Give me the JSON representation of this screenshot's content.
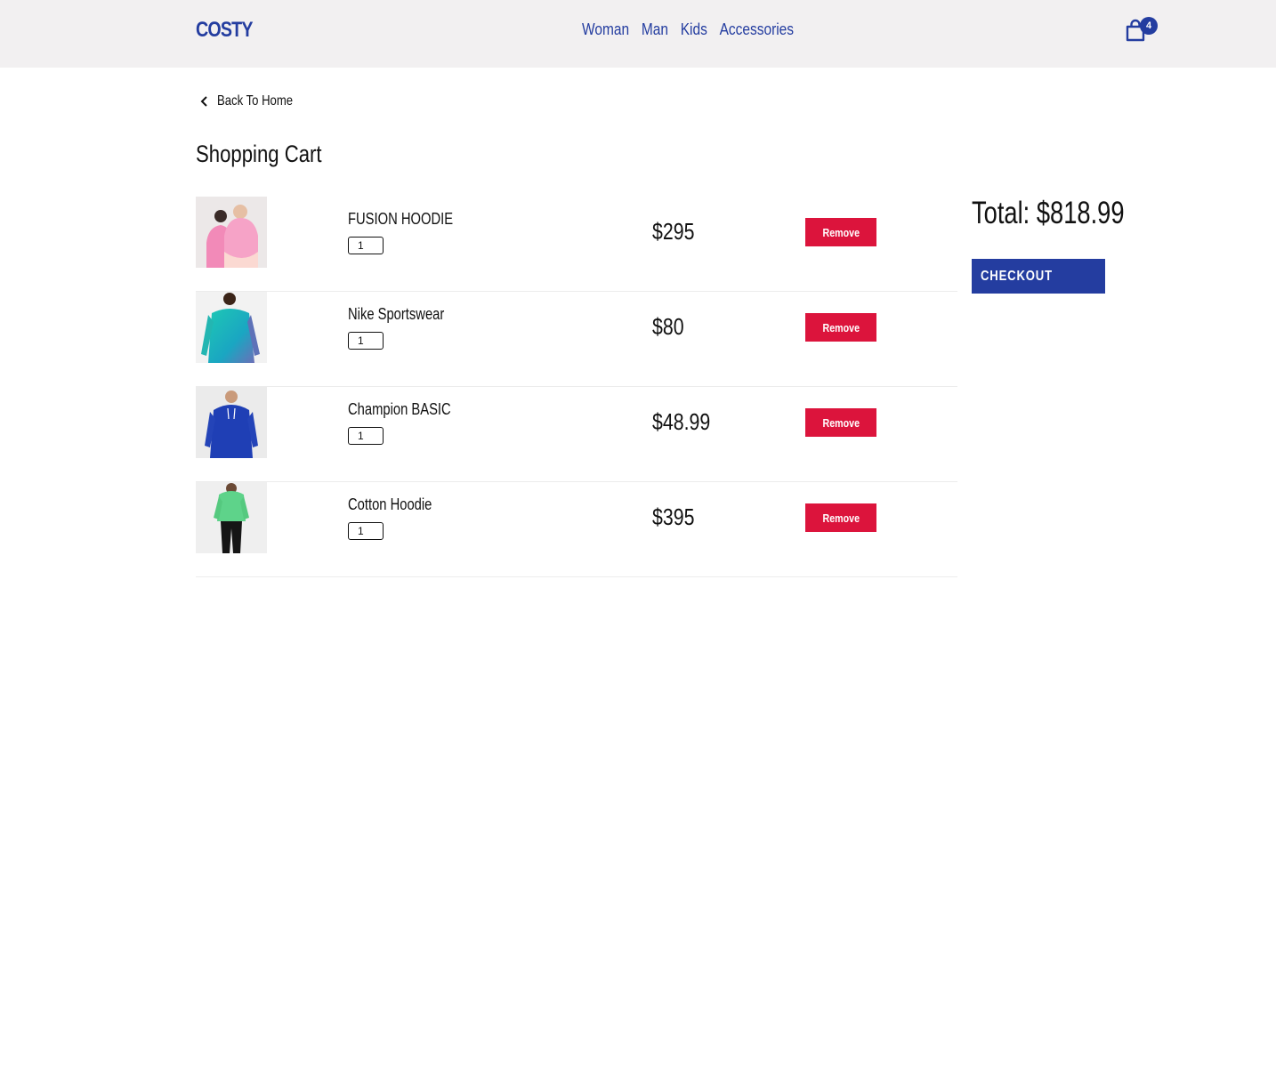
{
  "colors": {
    "brand": "#243da0",
    "header_bg": "#f2f0f1",
    "remove": "#dc143c",
    "text": "#111111"
  },
  "header": {
    "logo": "COSTY",
    "nav": [
      {
        "label": "Woman"
      },
      {
        "label": "Man"
      },
      {
        "label": "Kids"
      },
      {
        "label": "Accessories"
      }
    ],
    "cart_icon": "shopping-bag-icon",
    "cart_count": "4"
  },
  "back_link": {
    "icon": "chevron-left-icon",
    "label": "Back To Home"
  },
  "page_title": "Shopping Cart",
  "cart": {
    "items": [
      {
        "name": "FUSION HOODIE",
        "quantity": "1",
        "price": "$295",
        "remove_label": "Remove",
        "image": "pink-hoodie-photo"
      },
      {
        "name": "Nike Sportswear",
        "quantity": "1",
        "price": "$80",
        "remove_label": "Remove",
        "image": "teal-sweatshirt-photo"
      },
      {
        "name": "Champion BASIC",
        "quantity": "1",
        "price": "$48.99",
        "remove_label": "Remove",
        "image": "blue-hoodie-photo"
      },
      {
        "name": "Cotton Hoodie",
        "quantity": "1",
        "price": "$395",
        "remove_label": "Remove",
        "image": "green-hoodie-photo"
      }
    ]
  },
  "summary": {
    "total_label": "Total: $818.99",
    "checkout_label": "CHECKOUT"
  }
}
